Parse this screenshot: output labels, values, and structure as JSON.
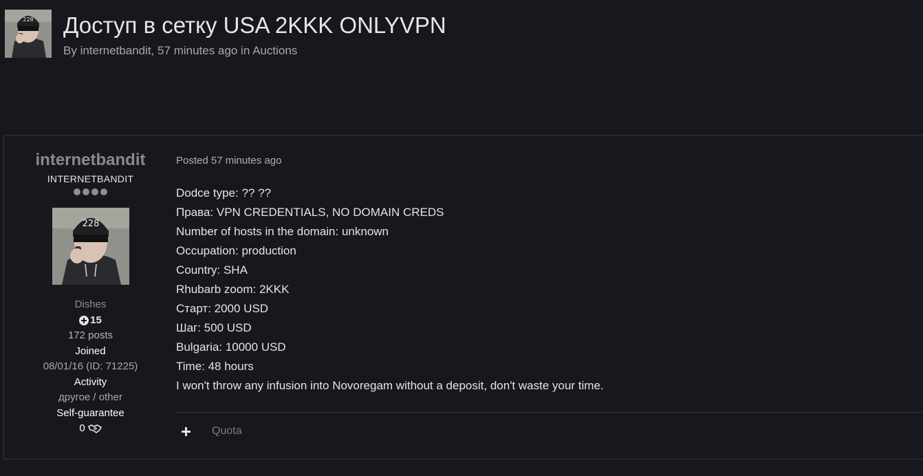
{
  "topic": {
    "title": "Доступ в сетку USA 2KKK ONLYVPN",
    "by_label": "By",
    "author": "internetbandit",
    "time": ", 57 minutes ago",
    "in_label": "in",
    "category": "Auctions"
  },
  "post": {
    "author": {
      "name": "internetbandit",
      "title": "INTERNETBANDIT",
      "rank_dots": 4,
      "group": "Dishes",
      "reputation": "15",
      "posts": "172 posts",
      "joined_label": "Joined",
      "joined_value": "08/01/16 (ID: 71225)",
      "activity_label": "Activity",
      "activity_value": "другое / other",
      "guarantee_label": "Self-guarantee",
      "guarantee_value": "0"
    },
    "posted": "Posted 57 minutes ago",
    "body": [
      "Dodce type: ?? ??",
      "Права: VPN CREDENTIALS, NO DOMAIN CREDS",
      "Number of hosts in the domain: unknown",
      "Occupation: production",
      "Country: SHA",
      "Rhubarb zoom: 2KKK",
      "Старт: 2000 USD",
      "Шаг: 500 USD",
      "Bulgaria: 10000 USD",
      "Time: 48 hours",
      "I won't throw any infusion into Novoregam without a deposit, don't waste your time."
    ],
    "actions": {
      "plus_icon": "plus-icon",
      "quote_label": "Quota"
    }
  },
  "colors": {
    "background": "#17181d",
    "border": "#34353b",
    "text": "#e4e4e4",
    "muted": "#a9a9a9"
  }
}
